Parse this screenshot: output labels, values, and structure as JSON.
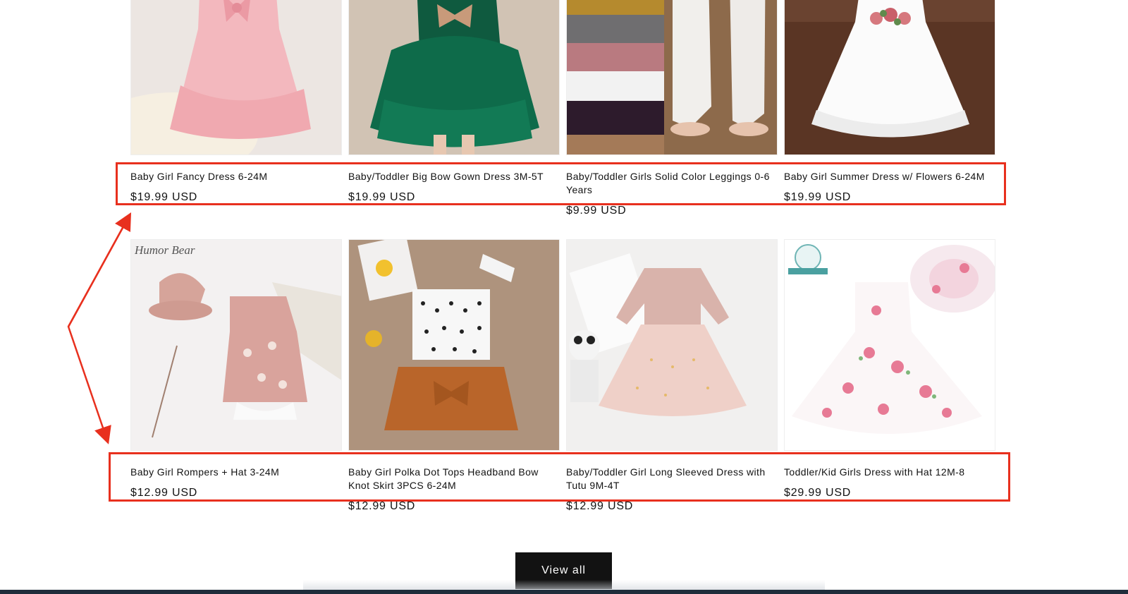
{
  "products_row1": [
    {
      "title": "Baby Girl Fancy Dress 6-24M",
      "price": "$19.99 USD",
      "image": "pink-tulle-dress"
    },
    {
      "title": "Baby/Toddler Big Bow Gown Dress 3M-5T",
      "price": "$19.99 USD",
      "image": "green-bow-gown"
    },
    {
      "title": "Baby/Toddler Girls Solid Color Leggings 0-6 Years",
      "price": "$9.99 USD",
      "image": "knit-leggings"
    },
    {
      "title": "Baby Girl Summer Dress w/ Flowers 6-24M",
      "price": "$19.99 USD",
      "image": "white-flower-dress"
    }
  ],
  "products_row2": [
    {
      "title": "Baby Girl Rompers + Hat 3-24M",
      "price": "$12.99 USD",
      "image": "pink-romper-hat",
      "brand_text": "Humor Bear"
    },
    {
      "title": "Baby Girl Polka Dot Tops Headband Bow Knot Skirt 3PCS 6-24M",
      "price": "$12.99 USD",
      "image": "polka-dot-set"
    },
    {
      "title": "Baby/Toddler Girl Long Sleeved Dress with Tutu 9M-4T",
      "price": "$12.99 USD",
      "image": "long-sleeve-tutu"
    },
    {
      "title": "Toddler/Kid Girls Dress with Hat 12M-8",
      "price": "$29.99 USD",
      "image": "floral-dress-hat"
    }
  ],
  "view_all_label": "View all",
  "colors": {
    "annotation": "#e8301e",
    "button_bg": "#121212",
    "text": "#121212"
  }
}
